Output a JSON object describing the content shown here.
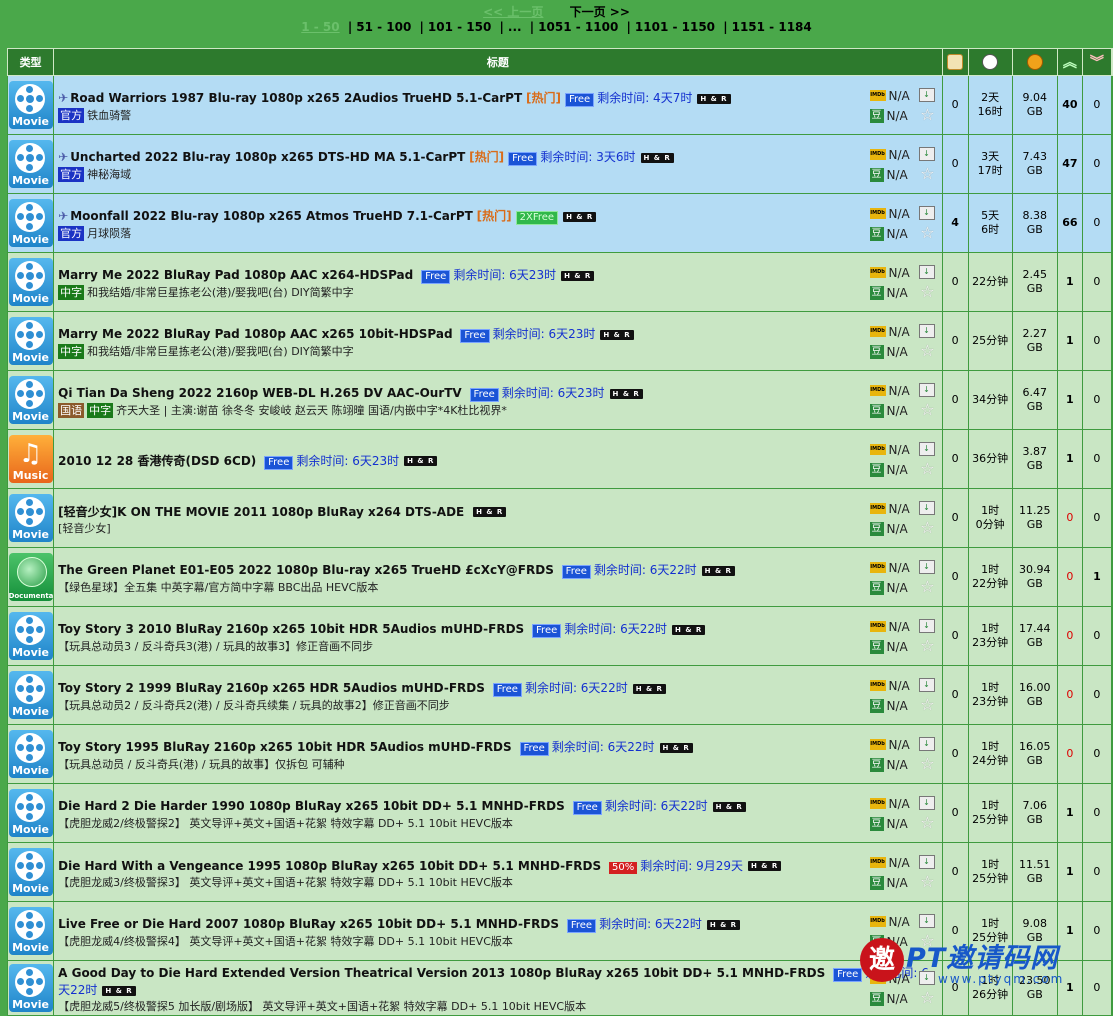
{
  "pager": {
    "prev": "<< 上一页",
    "next": "下一页 >>",
    "current": "1 - 50",
    "pages": [
      "51 - 100",
      "101 - 150",
      "...",
      "1051 - 1100",
      "1101 - 1150",
      "1151 - 1184"
    ]
  },
  "headers": {
    "type": "类型",
    "title": "标题"
  },
  "colors": {
    "header_bg": "#2d7a2d",
    "row_bg": "#c9e6c4",
    "sticky_bg": "#b4dcf4",
    "free": "#1b54d6",
    "hot": "#d96c1a"
  },
  "imdb_icon_text": "IMDb",
  "douban_icon_text": "豆",
  "hr_badge": "H & R",
  "torrents": [
    {
      "cat": "Movie",
      "pinned": true,
      "title": "Road Warriors 1987 Blu-ray 1080p x265 2Audios TrueHD 5.1-CarPT",
      "hot": "[热门]",
      "promo": "Free",
      "remain": "剩余时间: 4天7时",
      "hr": true,
      "tags": [
        "官方"
      ],
      "subtitle": "铁血骑警",
      "imdb": "N/A",
      "douban": "N/A",
      "comments": "0",
      "age": [
        "2天",
        "16时"
      ],
      "size": [
        "9.04",
        "GB"
      ],
      "seeders": "40",
      "leechers": "0"
    },
    {
      "cat": "Movie",
      "pinned": true,
      "title": "Uncharted 2022 Blu-ray 1080p x265 DTS-HD MA 5.1-CarPT",
      "hot": "[热门]",
      "promo": "Free",
      "remain": "剩余时间: 3天6时",
      "hr": true,
      "tags": [
        "官方"
      ],
      "subtitle": "神秘海域",
      "imdb": "N/A",
      "douban": "N/A",
      "comments": "0",
      "age": [
        "3天",
        "17时"
      ],
      "size": [
        "7.43",
        "GB"
      ],
      "seeders": "47",
      "leechers": "0"
    },
    {
      "cat": "Movie",
      "pinned": true,
      "title": "Moonfall 2022 Blu-ray 1080p x265 Atmos TrueHD 7.1-CarPT",
      "hot": "[热门]",
      "promo": "2XFree",
      "remain": "",
      "hr": true,
      "tags": [
        "官方"
      ],
      "subtitle": "月球陨落",
      "imdb": "N/A",
      "douban": "N/A",
      "comments": "4",
      "age": [
        "5天",
        "6时"
      ],
      "size": [
        "8.38",
        "GB"
      ],
      "seeders": "66",
      "leechers": "0"
    },
    {
      "cat": "Movie",
      "pinned": false,
      "title": "Marry Me 2022 BluRay Pad 1080p AAC x264-HDSPad",
      "hot": "",
      "promo": "Free",
      "remain": "剩余时间: 6天23时",
      "hr": true,
      "tags": [
        "中字"
      ],
      "subtitle": "和我结婚/非常巨星拣老公(港)/娶我吧(台) DIY简繁中字",
      "imdb": "N/A",
      "douban": "N/A",
      "comments": "0",
      "age": [
        "22分钟",
        ""
      ],
      "size": [
        "2.45",
        "GB"
      ],
      "seeders": "1",
      "leechers": "0"
    },
    {
      "cat": "Movie",
      "pinned": false,
      "title": "Marry Me 2022 BluRay Pad 1080p AAC x265 10bit-HDSPad",
      "hot": "",
      "promo": "Free",
      "remain": "剩余时间: 6天23时",
      "hr": true,
      "tags": [
        "中字"
      ],
      "subtitle": "和我结婚/非常巨星拣老公(港)/娶我吧(台) DIY简繁中字",
      "imdb": "N/A",
      "douban": "N/A",
      "comments": "0",
      "age": [
        "25分钟",
        ""
      ],
      "size": [
        "2.27",
        "GB"
      ],
      "seeders": "1",
      "leechers": "0"
    },
    {
      "cat": "Movie",
      "pinned": false,
      "title": "Qi Tian Da Sheng 2022 2160p WEB-DL H.265 DV AAC-OurTV",
      "hot": "",
      "promo": "Free",
      "remain": "剩余时间: 6天23时",
      "hr": true,
      "tags": [
        "国语",
        "中字"
      ],
      "subtitle": "齐天大圣 | 主演:谢苗 徐冬冬 安峻岐 赵云天 陈翊曈 国语/内嵌中字*4K杜比视界*",
      "imdb": "N/A",
      "douban": "N/A",
      "comments": "0",
      "age": [
        "34分钟",
        ""
      ],
      "size": [
        "6.47",
        "GB"
      ],
      "seeders": "1",
      "leechers": "0"
    },
    {
      "cat": "Music",
      "pinned": false,
      "title": "2010 12 28 香港传奇(DSD 6CD)",
      "hot": "",
      "promo": "Free",
      "remain": "剩余时间: 6天23时",
      "hr": true,
      "tags": [],
      "subtitle": "",
      "imdb": "N/A",
      "douban": "N/A",
      "comments": "0",
      "age": [
        "36分钟",
        ""
      ],
      "size": [
        "3.87",
        "GB"
      ],
      "seeders": "1",
      "leechers": "0"
    },
    {
      "cat": "Movie",
      "pinned": false,
      "title": "[轻音少女]K ON THE MOVIE 2011 1080p BluRay x264 DTS-ADE",
      "hot": "",
      "promo": "",
      "remain": "",
      "hr": true,
      "tags": [],
      "subtitle": "[轻音少女]",
      "imdb": "N/A",
      "douban": "N/A",
      "comments": "0",
      "age": [
        "1时",
        "0分钟"
      ],
      "size": [
        "11.25",
        "GB"
      ],
      "seeders": "0",
      "leechers": "0"
    },
    {
      "cat": "Documentary",
      "pinned": false,
      "title": "The Green Planet E01-E05 2022 1080p Blu-ray x265 TrueHD £cXcY@FRDS",
      "hot": "",
      "promo": "Free",
      "remain": "剩余时间: 6天22时",
      "hr": true,
      "tags": [],
      "subtitle": "【绿色星球】全五集 中英字幕/官方简中字幕 BBC出品 HEVC版本",
      "imdb": "N/A",
      "douban": "N/A",
      "comments": "0",
      "age": [
        "1时",
        "22分钟"
      ],
      "size": [
        "30.94",
        "GB"
      ],
      "seeders": "0",
      "leechers": "1"
    },
    {
      "cat": "Movie",
      "pinned": false,
      "title": "Toy Story 3 2010 BluRay 2160p x265 10bit HDR 5Audios mUHD-FRDS",
      "hot": "",
      "promo": "Free",
      "remain": "剩余时间: 6天22时",
      "hr": true,
      "tags": [],
      "subtitle": "【玩具总动员3 / 反斗奇兵3(港) / 玩具的故事3】修正音画不同步",
      "imdb": "N/A",
      "douban": "N/A",
      "comments": "0",
      "age": [
        "1时",
        "23分钟"
      ],
      "size": [
        "17.44",
        "GB"
      ],
      "seeders": "0",
      "leechers": "0"
    },
    {
      "cat": "Movie",
      "pinned": false,
      "title": "Toy Story 2 1999 BluRay 2160p x265 HDR 5Audios mUHD-FRDS",
      "hot": "",
      "promo": "Free",
      "remain": "剩余时间: 6天22时",
      "hr": true,
      "tags": [],
      "subtitle": "【玩具总动员2 / 反斗奇兵2(港) / 反斗奇兵续集 / 玩具的故事2】修正音画不同步",
      "imdb": "N/A",
      "douban": "N/A",
      "comments": "0",
      "age": [
        "1时",
        "23分钟"
      ],
      "size": [
        "16.00",
        "GB"
      ],
      "seeders": "0",
      "leechers": "0"
    },
    {
      "cat": "Movie",
      "pinned": false,
      "title": "Toy Story 1995 BluRay 2160p x265 10bit HDR 5Audios mUHD-FRDS",
      "hot": "",
      "promo": "Free",
      "remain": "剩余时间: 6天22时",
      "hr": true,
      "tags": [],
      "subtitle": "【玩具总动员 / 反斗奇兵(港) / 玩具的故事】仅拆包 可辅种",
      "imdb": "N/A",
      "douban": "N/A",
      "comments": "0",
      "age": [
        "1时",
        "24分钟"
      ],
      "size": [
        "16.05",
        "GB"
      ],
      "seeders": "0",
      "leechers": "0"
    },
    {
      "cat": "Movie",
      "pinned": false,
      "title": "Die Hard 2 Die Harder 1990 1080p BluRay x265 10bit DD+ 5.1 MNHD-FRDS",
      "hot": "",
      "promo": "Free",
      "remain": "剩余时间: 6天22时",
      "hr": true,
      "tags": [],
      "subtitle": "【虎胆龙威2/终极警探2】 英文导评+英文+国语+花絮 特效字幕 DD+ 5.1 10bit HEVC版本",
      "imdb": "N/A",
      "douban": "N/A",
      "comments": "0",
      "age": [
        "1时",
        "25分钟"
      ],
      "size": [
        "7.06",
        "GB"
      ],
      "seeders": "1",
      "leechers": "0"
    },
    {
      "cat": "Movie",
      "pinned": false,
      "title": "Die Hard With a Vengeance 1995 1080p BluRay x265 10bit DD+ 5.1 MNHD-FRDS",
      "hot": "",
      "promo": "50%",
      "remain": "剩余时间: 9月29天",
      "hr": true,
      "tags": [],
      "subtitle": "【虎胆龙威3/终极警探3】 英文导评+英文+国语+花絮 特效字幕 DD+ 5.1 10bit HEVC版本",
      "imdb": "N/A",
      "douban": "N/A",
      "comments": "0",
      "age": [
        "1时",
        "25分钟"
      ],
      "size": [
        "11.51",
        "GB"
      ],
      "seeders": "1",
      "leechers": "0"
    },
    {
      "cat": "Movie",
      "pinned": false,
      "title": "Live Free or Die Hard 2007 1080p BluRay x265 10bit DD+ 5.1 MNHD-FRDS",
      "hot": "",
      "promo": "Free",
      "remain": "剩余时间: 6天22时",
      "hr": true,
      "tags": [],
      "subtitle": "【虎胆龙威4/终极警探4】 英文导评+英文+国语+花絮 特效字幕 DD+ 5.1 10bit HEVC版本",
      "imdb": "N/A",
      "douban": "N/A",
      "comments": "0",
      "age": [
        "1时",
        "25分钟"
      ],
      "size": [
        "9.08",
        "GB"
      ],
      "seeders": "1",
      "leechers": "0"
    },
    {
      "cat": "Movie",
      "pinned": false,
      "title": "A Good Day to Die Hard Extended Version Theatrical Version 2013 1080p BluRay x265 10bit DD+ 5.1 MNHD-FRDS",
      "hot": "",
      "promo": "Free",
      "remain": "剩余时间: 6天22时",
      "hr": true,
      "tags": [],
      "subtitle": "【虎胆龙威5/终极警探5 加长版/剧场版】 英文导评+英文+国语+花絮 特效字幕 DD+ 5.1 10bit HEVC版本",
      "imdb": "N/A",
      "douban": "N/A",
      "comments": "0",
      "age": [
        "1时",
        "26分钟"
      ],
      "size": [
        "23.50",
        "GB"
      ],
      "seeders": "1",
      "leechers": "0"
    }
  ],
  "watermark": {
    "brand": "PT邀请码网",
    "url": "www.ptyqm.com",
    "logo_char": "邀"
  }
}
